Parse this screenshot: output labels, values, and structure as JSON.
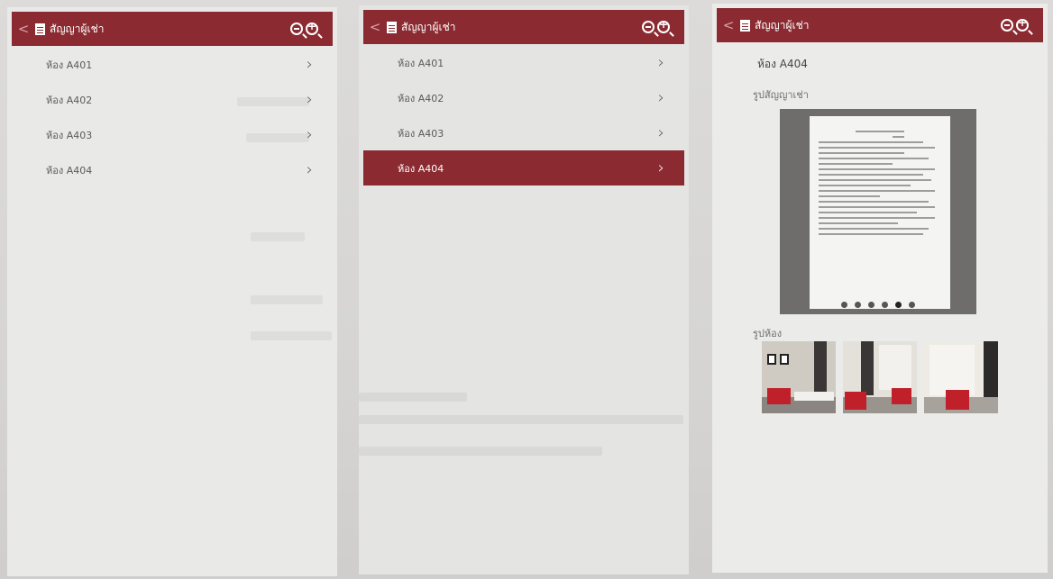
{
  "header": {
    "title": "สัญญาผู้เช่า",
    "back": "<"
  },
  "rooms": [
    {
      "label": "ห้อง A401"
    },
    {
      "label": "ห้อง A402"
    },
    {
      "label": "ห้อง A403"
    },
    {
      "label": "ห้อง A404"
    }
  ],
  "selected_room": "ห้อง A404",
  "detail": {
    "room_name": "ห้อง A404",
    "contract_label": "รูปสัญญาเช่า",
    "room_photos_label": "รูปห้อง",
    "carousel": {
      "pages": 6,
      "active_page": 5
    }
  },
  "icons": {
    "back": "chevron-left-icon",
    "doc": "document-icon",
    "zoom_out": "zoom-out-icon",
    "zoom_in": "zoom-in-icon",
    "row": "chevron-right-icon"
  },
  "colors": {
    "brand": "#8b2a31",
    "background": "#ebebea",
    "text": "#5a5a5a"
  }
}
